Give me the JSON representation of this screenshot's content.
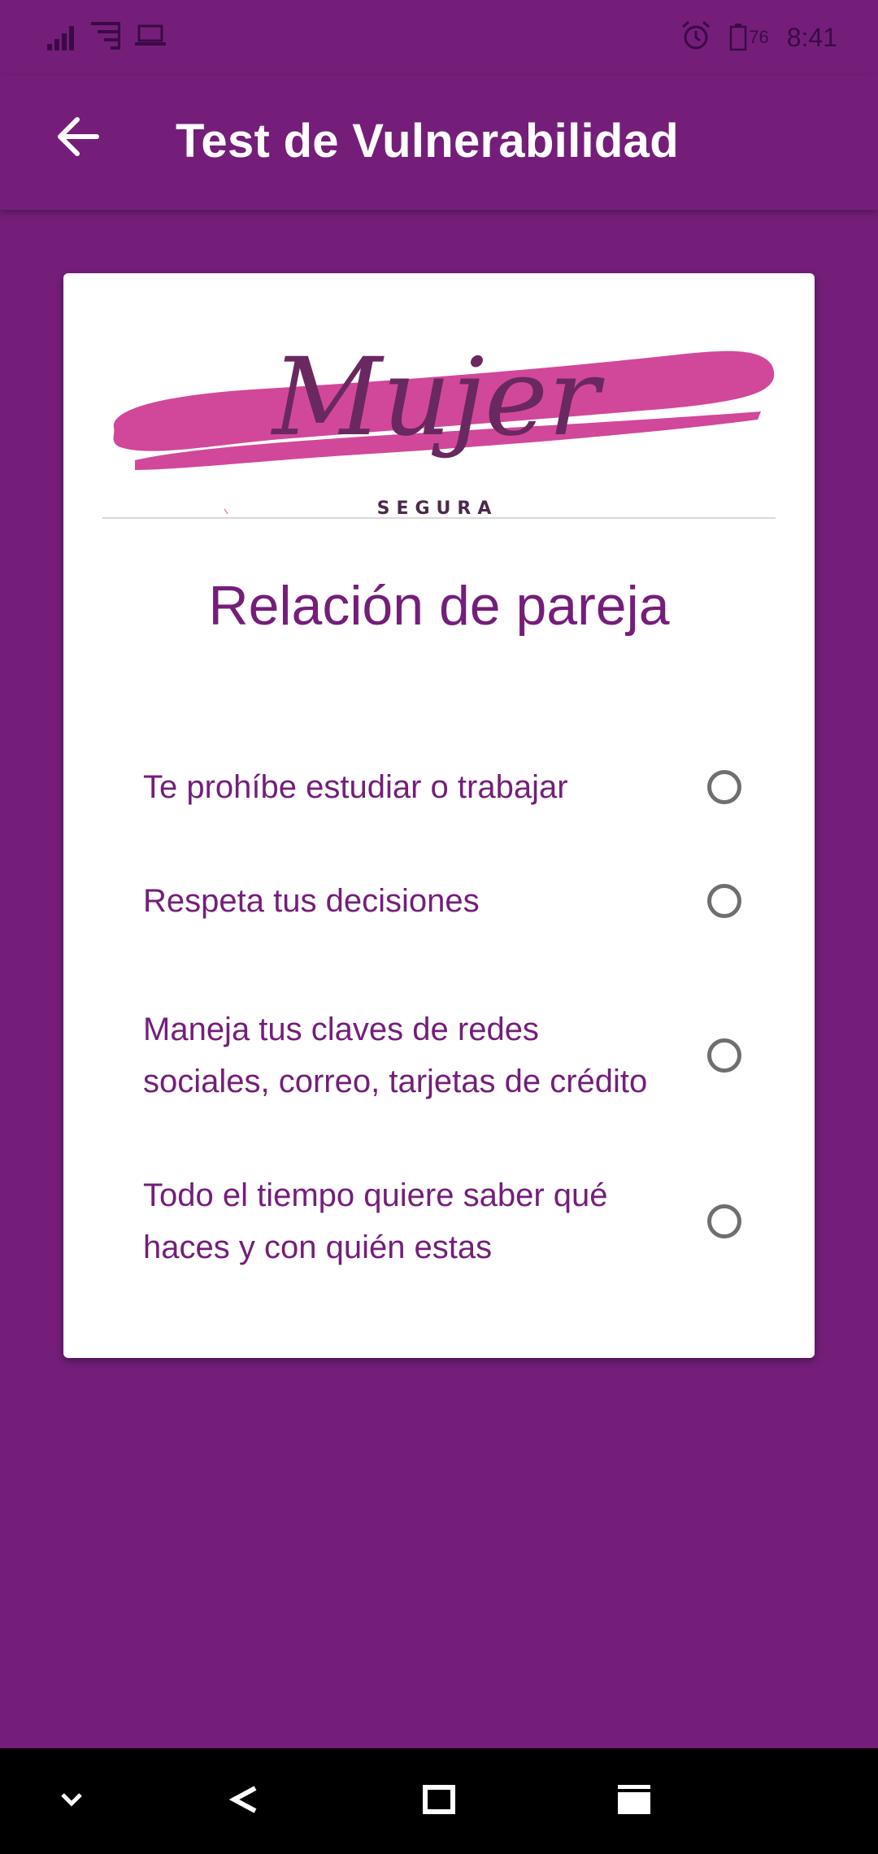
{
  "status_bar": {
    "time": "8:41",
    "battery_level": "76",
    "icons": [
      "signal-icon",
      "wifi-icon",
      "laptop-icon",
      "alarm-icon",
      "battery-icon"
    ]
  },
  "app_bar": {
    "title": "Test de Vulnerabilidad",
    "back_icon": "arrow-back-icon"
  },
  "card": {
    "logo": {
      "main": "Mujer",
      "sub": "SEGURA"
    },
    "title": "Relación de pareja",
    "options": [
      {
        "label": "Te prohíbe estudiar o trabajar",
        "selected": false
      },
      {
        "label": "Respeta tus decisiones",
        "selected": false
      },
      {
        "label": "Maneja tus claves de redes sociales, correo, tarjetas de crédito",
        "selected": false
      },
      {
        "label": "Todo el tiempo quiere saber qué haces y con quién estas",
        "selected": false
      }
    ]
  },
  "nav_bar": {
    "buttons": [
      "chevron-down-icon",
      "back-icon",
      "home-icon",
      "recents-icon"
    ]
  },
  "colors": {
    "primary": "#741e7a",
    "logo_brush": "#d1489a",
    "logo_text": "#6a2860",
    "radio": "#6f6f6f"
  }
}
